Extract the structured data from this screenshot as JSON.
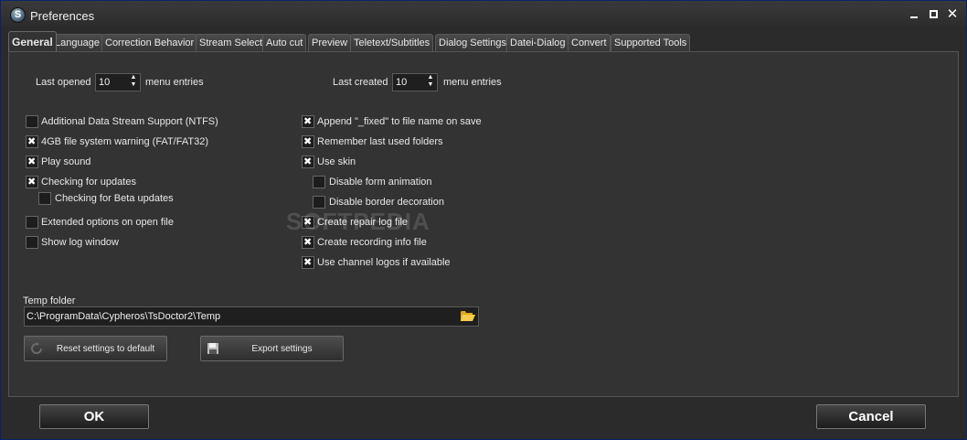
{
  "window": {
    "title": "Preferences"
  },
  "tabs": [
    {
      "label": "General",
      "active": true
    },
    {
      "label": "Language"
    },
    {
      "label": "Correction Behavior"
    },
    {
      "label": "Stream Select"
    },
    {
      "label": "Auto cut"
    },
    {
      "label": "Preview"
    },
    {
      "label": "Teletext/Subtitles"
    },
    {
      "label": "Dialog Settings"
    },
    {
      "label": "Datei-Dialog"
    },
    {
      "label": "Convert"
    },
    {
      "label": "Supported Tools"
    }
  ],
  "general": {
    "last_opened": {
      "label": "Last opened",
      "value": "10",
      "suffix": "menu entries"
    },
    "last_created": {
      "label": "Last created",
      "value": "10",
      "suffix": "menu entries"
    },
    "left_options": [
      {
        "label": "Additional Data Stream Support (NTFS)",
        "checked": false
      },
      {
        "label": "4GB file system warning (FAT/FAT32)",
        "checked": true
      },
      {
        "label": "Play sound",
        "checked": true
      },
      {
        "label": "Checking for updates",
        "checked": true
      },
      {
        "label": "Checking for Beta updates",
        "checked": false
      },
      {
        "label": "Extended options on open file",
        "checked": false
      },
      {
        "label": "Show log window",
        "checked": false
      }
    ],
    "right_options": [
      {
        "label": "Append \"_fixed\" to file name on save",
        "checked": true
      },
      {
        "label": "Remember last used folders",
        "checked": true
      },
      {
        "label": "Use skin",
        "checked": true
      },
      {
        "label": "Disable form animation",
        "checked": false
      },
      {
        "label": "Disable border decoration",
        "checked": false
      },
      {
        "label": "Create repair log file",
        "checked": true
      },
      {
        "label": "Create recording info file",
        "checked": true
      },
      {
        "label": "Use channel logos if available",
        "checked": true
      }
    ],
    "temp_folder": {
      "label": "Temp folder",
      "value": "C:\\ProgramData\\Cypheros\\TsDoctor2\\Temp"
    },
    "reset_button": "Reset settings to default",
    "export_button": "Export settings"
  },
  "footer": {
    "ok": "OK",
    "cancel": "Cancel"
  },
  "watermark": "SOFTPEDIA"
}
